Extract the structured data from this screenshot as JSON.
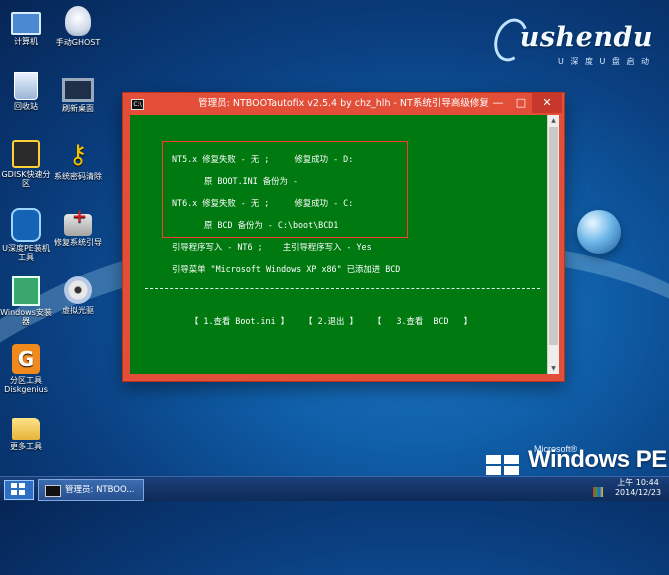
{
  "desktop": {
    "brand": {
      "logo": "ushendu",
      "sub": "U 深 度 U 盘 启 动"
    },
    "icons": [
      {
        "label": "计算机",
        "icon": "computer-icon"
      },
      {
        "label": "手动GHOST",
        "icon": "ghost-icon"
      },
      {
        "label": "回收站",
        "icon": "recycle-bin-icon"
      },
      {
        "label": "刷新桌面",
        "icon": "monitor-icon"
      },
      {
        "label": "GDISK快速分区",
        "icon": "gdisk-icon"
      },
      {
        "label": "系统密码清除",
        "icon": "key-icon"
      },
      {
        "label": "U深度PE装机工具",
        "icon": "usd-installer-icon"
      },
      {
        "label": "修复系统引导",
        "icon": "toolbox-icon"
      },
      {
        "label": "Windows安装器",
        "icon": "setup-icon"
      },
      {
        "label": "虚拟光驱",
        "icon": "cd-icon"
      },
      {
        "label": "分区工具Diskgenius",
        "icon": "diskgenius-icon"
      },
      {
        "label": "更多工具",
        "icon": "folder-icon"
      }
    ]
  },
  "window": {
    "title": "管理员:  NTBOOTautofix v2.5.4 by chz_hlh - NT系统引导高级修复",
    "buttons": {
      "minimize": "—",
      "maximize": "□",
      "close": "✕"
    },
    "lines": {
      "nt5": "NT5.x 修复失败 - 无 ;     修复成功 - D:",
      "nt5_backup": "原 BOOT.INI 备份为 -",
      "nt6": "NT6.x 修复失败 - 无 ;     修复成功 - C:",
      "nt6_backup": "原 BCD 备份为 - C:\\boot\\BCD1",
      "boot_write": "引导程序写入 - NT6 ;    主引导程序写入 - Yes",
      "boot_menu": "引导菜单 \"Microsoft Windows XP x86\" 已添加进 BCD",
      "menu": "【 1.查看 Boot.ini 】   【 2.退出 】   【   3.查看  BCD   】"
    }
  },
  "taskbar": {
    "task_label": "管理员: NTBOO...",
    "clock_time": "上午 10:44",
    "clock_date": "2014/12/23"
  },
  "watermark": {
    "ms": "Microsoft®",
    "text": "Windows PE"
  }
}
